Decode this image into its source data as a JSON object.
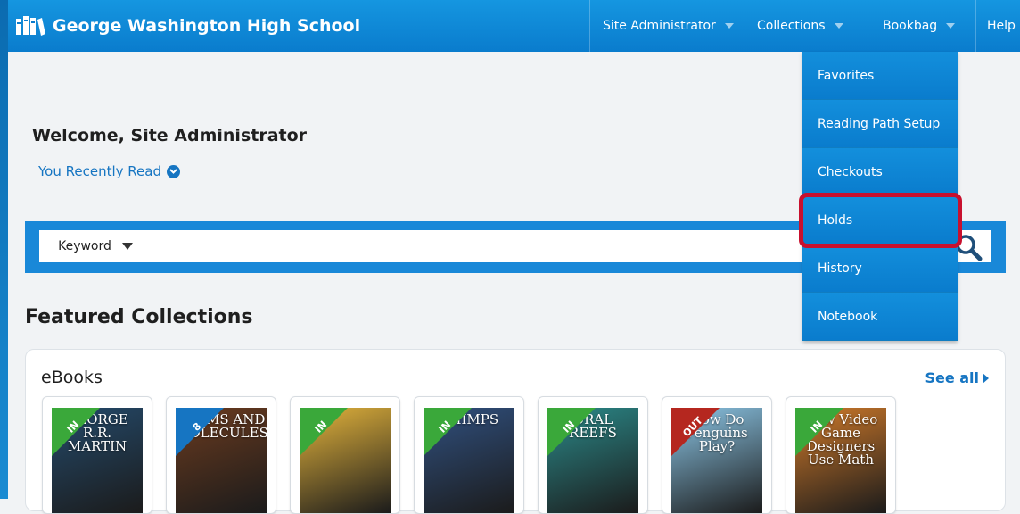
{
  "header": {
    "title": "George Washington High School",
    "nav": [
      {
        "label": "Site Administrator",
        "has_caret": true
      },
      {
        "label": "Collections",
        "has_caret": true
      },
      {
        "label": "Bookbag",
        "has_caret": true
      },
      {
        "label": "Help",
        "has_caret": false
      }
    ]
  },
  "bookbag_menu": {
    "items": [
      "Favorites",
      "Reading Path Setup",
      "Checkouts",
      "Holds",
      "History",
      "Notebook"
    ],
    "highlighted": "Holds",
    "highlight_color": "#c8102e"
  },
  "welcome": {
    "title": "Welcome, Site Administrator",
    "recently_read": "You Recently Read"
  },
  "search": {
    "type_label": "Keyword",
    "value": ""
  },
  "featured": {
    "title": "Featured Collections",
    "collection": {
      "name": "eBooks",
      "see_all": "See all",
      "books": [
        {
          "status": "IN",
          "cover_text": "GEORGE R.R. MARTIN",
          "ribbon_color": "#3aa83a",
          "cover_color": "#244a6b"
        },
        {
          "status": "8",
          "cover_text": "ATOMS AND MOLECULES",
          "ribbon_color": "#1675c2",
          "cover_color": "#6b3b1f"
        },
        {
          "status": "IN",
          "cover_text": "",
          "ribbon_color": "#3aa83a",
          "cover_color": "#e4b43c"
        },
        {
          "status": "IN",
          "cover_text": "CHIMPS",
          "ribbon_color": "#3aa83a",
          "cover_color": "#30507f"
        },
        {
          "status": "IN",
          "cover_text": "ORAL REEFS",
          "ribbon_color": "#3aa83a",
          "cover_color": "#2b8a8a"
        },
        {
          "status": "OUT",
          "cover_text": "How Do Penguins Play?",
          "ribbon_color": "#b5271f",
          "cover_color": "#8cc6e6"
        },
        {
          "status": "IN",
          "cover_text": "How Video Game Designers Use Math",
          "ribbon_color": "#3aa83a",
          "cover_color": "#d07a2a"
        }
      ]
    }
  },
  "colors": {
    "accent": "#1675c2",
    "header_blue": "#0a7ccd"
  }
}
